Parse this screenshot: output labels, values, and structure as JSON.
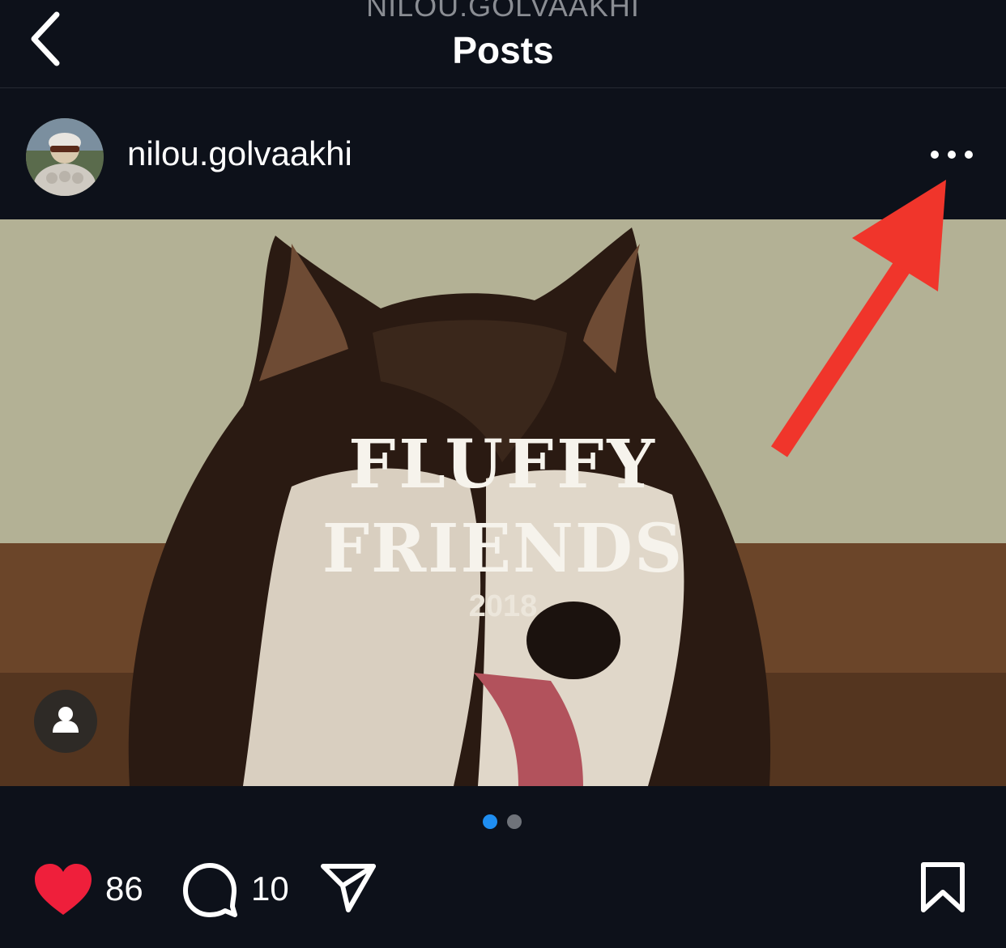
{
  "header": {
    "owner": "NILOU.GOLVAAKHI",
    "title": "Posts",
    "back_icon": "chevron-left-icon"
  },
  "post": {
    "username": "nilou.golvaakhi",
    "more_icon": "more-horizontal-icon",
    "media": {
      "line1": "FLUFFY",
      "line2": "FRIENDS",
      "year": "2018",
      "tag_icon": "person-tag-icon"
    },
    "carousel": {
      "total": 2,
      "active_index": 0
    },
    "actions": {
      "likes": "86",
      "comments": "10",
      "like_icon": "heart-icon",
      "comment_icon": "comment-icon",
      "share_icon": "send-icon",
      "save_icon": "bookmark-icon",
      "liked": true
    }
  },
  "colors": {
    "background": "#0d111a",
    "like": "#ef1f3b",
    "active_dot": "#1f8ef1",
    "annotation_arrow": "#f0352b"
  }
}
